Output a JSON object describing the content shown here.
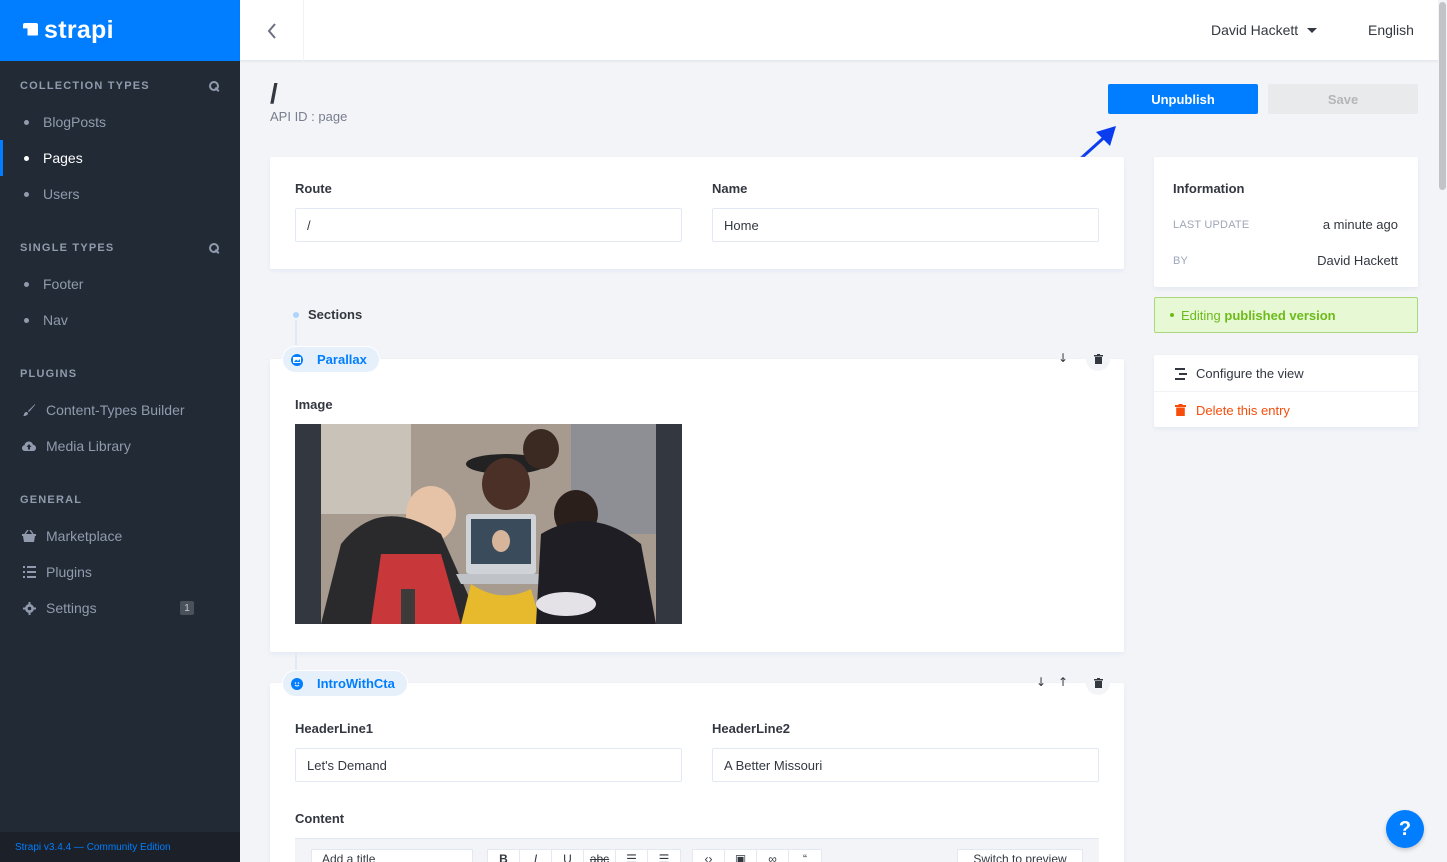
{
  "brand": {
    "name": "strapi"
  },
  "sidebar": {
    "collection_types_title": "COLLECTION TYPES",
    "collection_types": [
      "BlogPosts",
      "Pages",
      "Users"
    ],
    "active_item": "Pages",
    "single_types_title": "SINGLE TYPES",
    "single_types": [
      "Footer",
      "Nav"
    ],
    "plugins_title": "PLUGINS",
    "plugins": [
      {
        "label": "Content-Types Builder",
        "icon": "paintbrush-icon"
      },
      {
        "label": "Media Library",
        "icon": "cloud-upload-icon"
      }
    ],
    "general_title": "GENERAL",
    "general": [
      {
        "label": "Marketplace",
        "icon": "shopping-basket-icon"
      },
      {
        "label": "Plugins",
        "icon": "list-icon"
      },
      {
        "label": "Settings",
        "icon": "gear-icon",
        "badge": "1"
      }
    ],
    "footer": "Strapi v3.4.4 — Community Edition"
  },
  "header": {
    "user_name": "David Hackett",
    "language": "English"
  },
  "page": {
    "title": "/",
    "api_id": "API ID : page",
    "unpublish_label": "Unpublish",
    "save_label": "Save"
  },
  "fields": {
    "route_label": "Route",
    "route_value": "/",
    "name_label": "Name",
    "name_value": "Home"
  },
  "sections": {
    "title": "Sections",
    "parallax": {
      "name": "Parallax",
      "image_label": "Image"
    },
    "intro": {
      "name": "IntroWithCta",
      "header1_label": "HeaderLine1",
      "header1_value": "Let's Demand",
      "header2_label": "HeaderLine2",
      "header2_value": "A Better Missouri",
      "content_label": "Content"
    }
  },
  "editor_toolbar": {
    "select_value": "Add a title",
    "text_buttons": [
      "B",
      "I",
      "U",
      "abc"
    ],
    "preview_label": "Switch to preview"
  },
  "info": {
    "title": "Information",
    "last_update_key": "LAST UPDATE",
    "last_update_value": "a minute ago",
    "by_key": "BY",
    "by_value": "David Hackett"
  },
  "status": {
    "prefix": "Editing ",
    "emphasis": "published version"
  },
  "actions": {
    "configure_label": "Configure the view",
    "delete_label": "Delete this entry"
  },
  "help": {
    "label": "?"
  },
  "colors": {
    "accent": "#007eff",
    "sidebar_bg": "#222a35",
    "success": "#6dbb1a",
    "danger": "#f64d0a"
  }
}
